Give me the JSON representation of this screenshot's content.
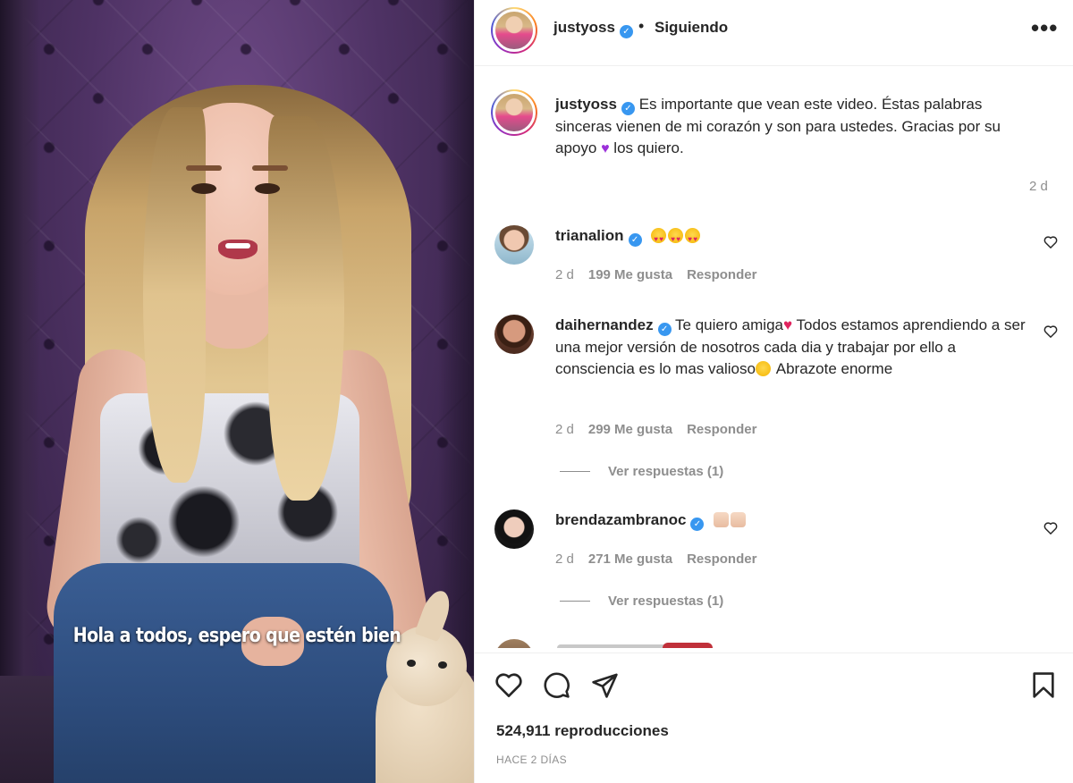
{
  "video": {
    "subtitle": "Hola a todos, espero que estén bien"
  },
  "header": {
    "username": "justyoss",
    "separator": "•",
    "follow_status": "Siguiendo",
    "more_icon": "more-horizontal-icon"
  },
  "post_caption": {
    "username": "justyoss",
    "text_part1": "Es importante que vean este video. Éstas palabras sinceras vienen de mi corazón y son para ustedes. Gracias por su apoyo",
    "emoji": "💜",
    "text_part2": "los quiero.",
    "age": "2 d"
  },
  "comments": [
    {
      "username": "trianalion",
      "text": "",
      "emojis": "😍😍😍",
      "age": "2 d",
      "likes": "199 Me gusta",
      "reply_label": "Responder"
    },
    {
      "username": "daihernandez",
      "text_part1": "Te quiero amiga",
      "emoji1": "💖",
      "text_part2": "Todos estamos aprendiendo a ser una mejor versión de nosotros cada dia y trabajar por ello a consciencia es lo mas valioso",
      "emoji2": "🙂",
      "text_part3": "Abrazote enorme",
      "age": "2 d",
      "likes": "299 Me gusta",
      "reply_label": "Responder",
      "view_replies": "Ver respuestas (1)"
    },
    {
      "username": "brendazambranoc",
      "emojis": "🙌🙌",
      "age": "2 d",
      "likes": "271 Me gusta",
      "reply_label": "Responder",
      "view_replies": "Ver respuestas (1)"
    }
  ],
  "footer": {
    "views": "524,911 reproducciones",
    "timestamp": "HACE 2 DÍAS"
  },
  "colors": {
    "verified": "#3897f0",
    "muted_text": "#8e8e8e",
    "caption_heart": "#9b30d9"
  }
}
